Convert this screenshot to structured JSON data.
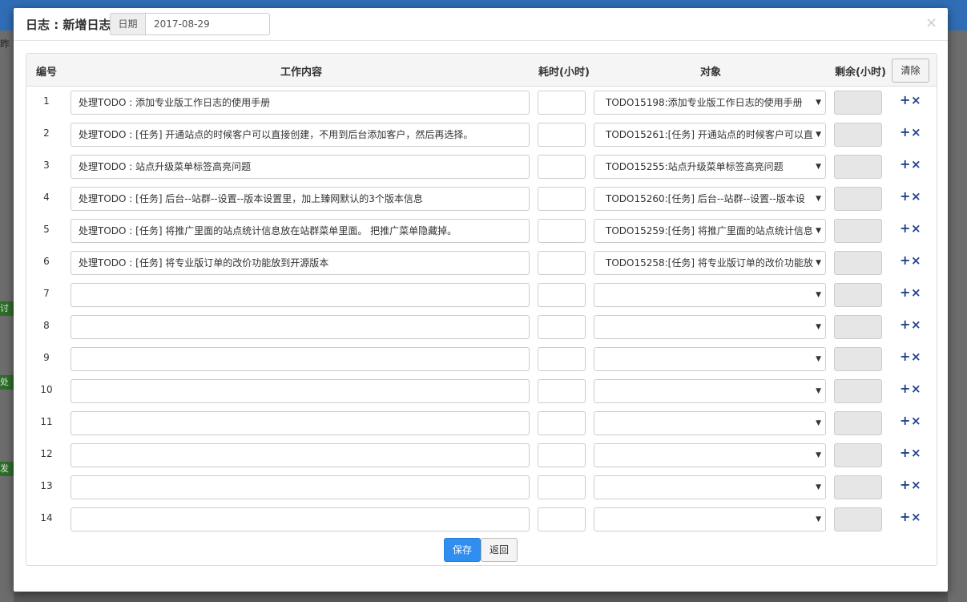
{
  "background": {
    "tag_1": "讨议",
    "tag_2": "处理",
    "tag_3": "发布",
    "left_text": "昨天"
  },
  "modal": {
    "title": "日志 : 新增日志",
    "date_label": "日期",
    "date_value": "2017-08-29",
    "close_icon": "×"
  },
  "table": {
    "headers": {
      "num": "编号",
      "content": "工作内容",
      "hours": "耗时(小时)",
      "target": "对象",
      "remaining": "剩余(小时)"
    },
    "clear_label": "清除",
    "rows": [
      {
        "num": "1",
        "content": "处理TODO : 添加专业版工作日志的使用手册",
        "target": "TODO15198:添加专业版工作日志的使用手册"
      },
      {
        "num": "2",
        "content": "处理TODO : [任务] 开通站点的时候客户可以直接创建，不用到后台添加客户，然后再选择。",
        "target": "TODO15261:[任务] 开通站点的时候客户可以直"
      },
      {
        "num": "3",
        "content": "处理TODO : 站点升级菜单标签高亮问题",
        "target": "TODO15255:站点升级菜单标签高亮问题"
      },
      {
        "num": "4",
        "content": "处理TODO : [任务] 后台--站群--设置--版本设置里，加上臻网默认的3个版本信息",
        "target": "TODO15260:[任务] 后台--站群--设置--版本设"
      },
      {
        "num": "5",
        "content": "处理TODO : [任务] 将推广里面的站点统计信息放在站群菜单里面。 把推广菜单隐藏掉。",
        "target": "TODO15259:[任务] 将推广里面的站点统计信息"
      },
      {
        "num": "6",
        "content": "处理TODO : [任务] 将专业版订单的改价功能放到开源版本",
        "target": "TODO15258:[任务] 将专业版订单的改价功能放"
      },
      {
        "num": "7",
        "content": "",
        "target": ""
      },
      {
        "num": "8",
        "content": "",
        "target": ""
      },
      {
        "num": "9",
        "content": "",
        "target": ""
      },
      {
        "num": "10",
        "content": "",
        "target": ""
      },
      {
        "num": "11",
        "content": "",
        "target": ""
      },
      {
        "num": "12",
        "content": "",
        "target": ""
      },
      {
        "num": "13",
        "content": "",
        "target": ""
      },
      {
        "num": "14",
        "content": "",
        "target": ""
      }
    ],
    "add_icon": "+",
    "remove_icon": "×"
  },
  "footer": {
    "save_label": "保存",
    "back_label": "返回"
  },
  "colors": {
    "primary_button": "#2f8ef0",
    "action_icon": "#22418f",
    "topbar": "#2f6eb6",
    "tag_green": "#2e6d2a"
  }
}
